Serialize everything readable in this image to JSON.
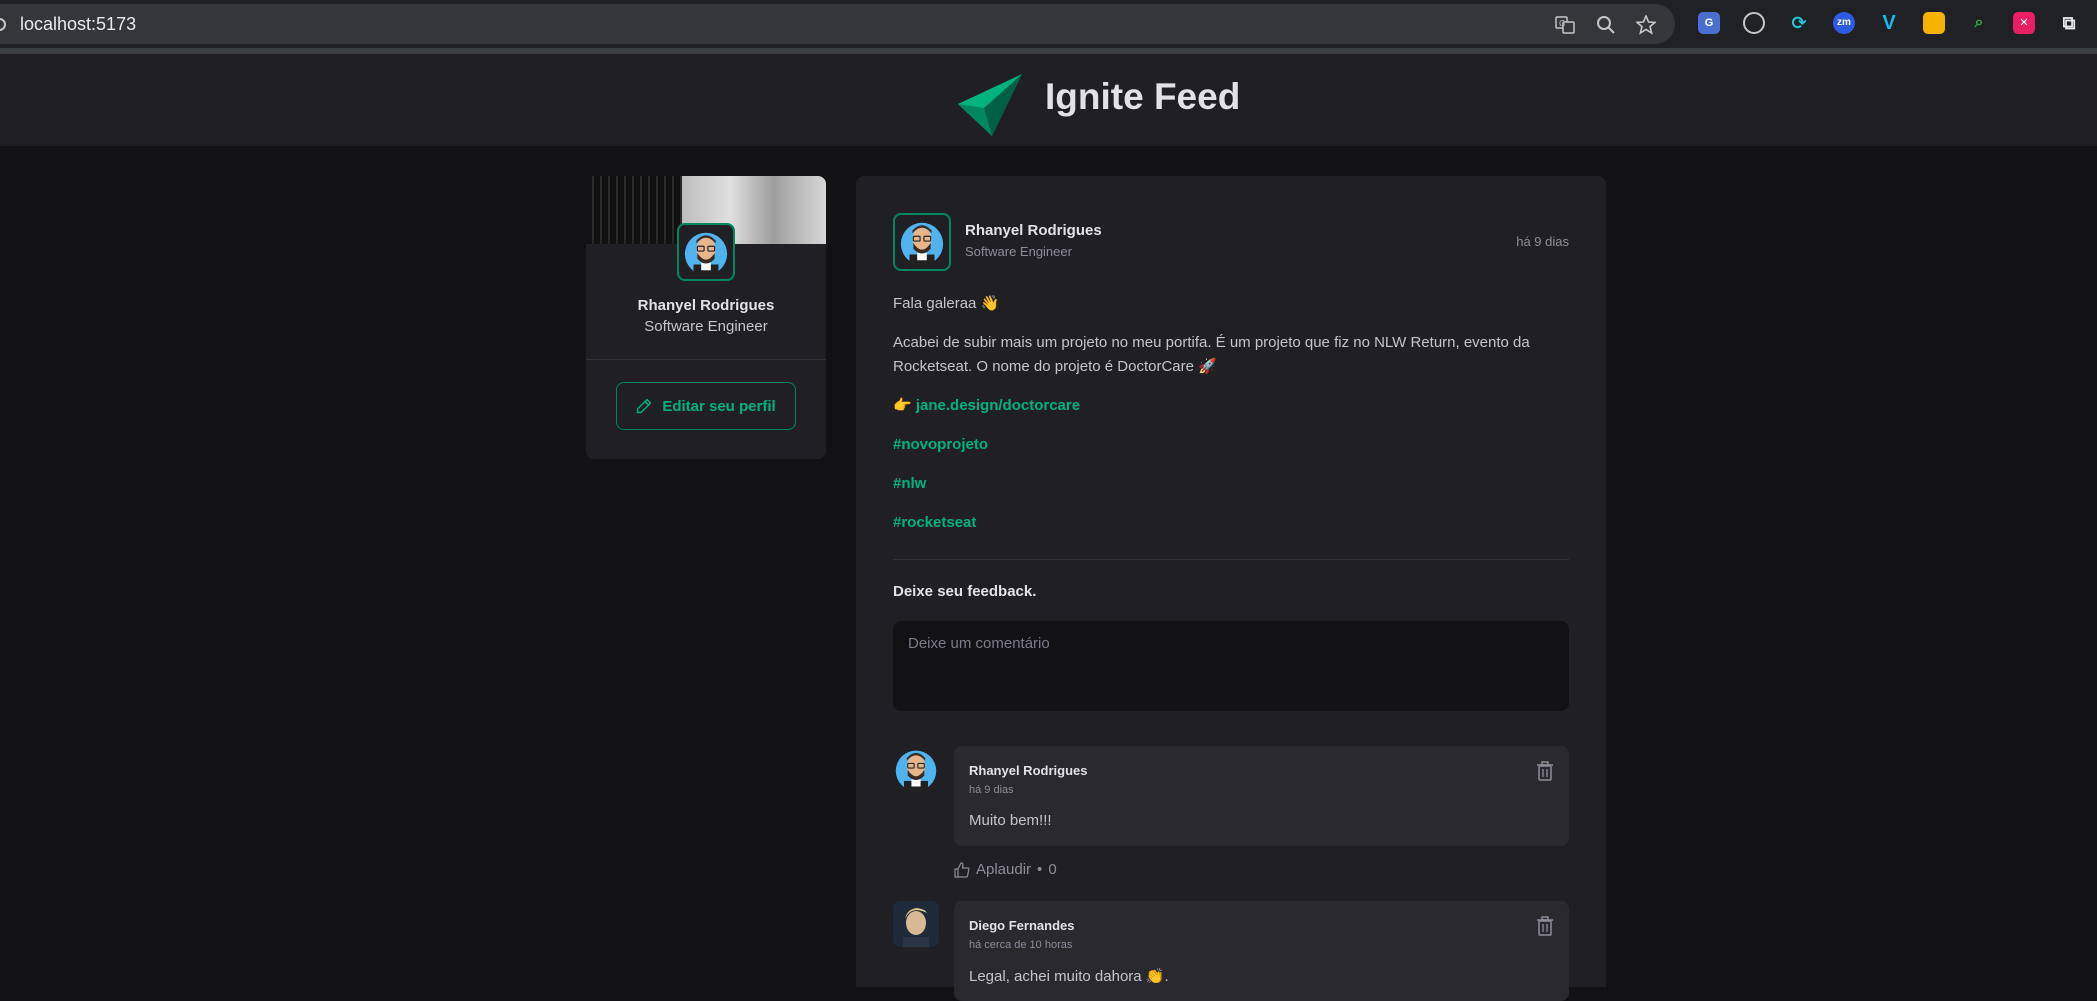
{
  "browser": {
    "url": "localhost:5173"
  },
  "header": {
    "title": "Ignite Feed"
  },
  "sidebar": {
    "name": "Rhanyel Rodrigues",
    "role": "Software Engineer",
    "edit_label": "Editar seu perfil"
  },
  "post": {
    "author_name": "Rhanyel Rodrigues",
    "author_role": "Software Engineer",
    "time": "há 9 dias",
    "greeting": "Fala galeraa 👋",
    "body_line1": "Acabei de subir mais um projeto no meu portifa. É um projeto que fiz no NLW Return, evento da",
    "body_line2": "Rocketseat. O nome do projeto é DoctorCare 🚀",
    "link_prefix": "👉 ",
    "link": "jane.design/doctorcare",
    "hashtags": [
      "#novoprojeto",
      "#nlw",
      "#rocketseat"
    ],
    "feedback_title": "Deixe seu feedback.",
    "comment_placeholder": "Deixe um comentário"
  },
  "comments": [
    {
      "author": "Rhanyel Rodrigues",
      "time": "há 9 dias",
      "text": "Muito bem!!!",
      "applaud_label": "Aplaudir",
      "applaud_count": "0"
    },
    {
      "author": "Diego Fernandes",
      "time": "há cerca de 10 horas",
      "text": "Legal, achei muito dahora 👏."
    }
  ],
  "colors": {
    "brand": "#00875f",
    "brand_light": "#00b37e",
    "background": "#121214",
    "card": "#202024"
  }
}
